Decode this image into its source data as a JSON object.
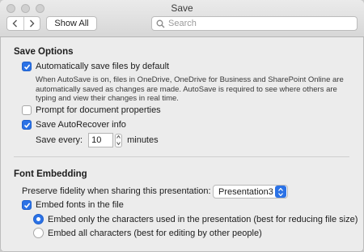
{
  "window": {
    "title": "Save"
  },
  "toolbar": {
    "show_all_label": "Show All",
    "search_placeholder": "Search",
    "back_icon": "chevron-left-icon",
    "forward_icon": "chevron-right-icon",
    "search_icon": "search-icon"
  },
  "save_options": {
    "title": "Save Options",
    "autosave": {
      "label": "Automatically save files by default",
      "checked": true,
      "description": "When AutoSave is on, files in OneDrive, OneDrive for Business and SharePoint Online are automatically saved as changes are made. AutoSave is required to see where others are typing and view their changes in real time."
    },
    "prompt_properties": {
      "label": "Prompt for document properties",
      "checked": false
    },
    "autorecover": {
      "label": "Save AutoRecover info",
      "checked": true
    },
    "save_every": {
      "label": "Save every:",
      "value": "10",
      "unit": "minutes"
    }
  },
  "font_embedding": {
    "title": "Font Embedding",
    "preserve_label": "Preserve fidelity when sharing this presentation:",
    "presentation_select": "Presentation3",
    "embed_fonts": {
      "label": "Embed fonts in the file",
      "checked": true
    },
    "options": [
      {
        "label": "Embed only the characters used in the presentation (best for reducing file size)",
        "selected": true
      },
      {
        "label": "Embed all characters (best for editing by other people)",
        "selected": false
      }
    ]
  },
  "colors": {
    "accent": "#2b72e6",
    "window_bg": "#ececec"
  }
}
